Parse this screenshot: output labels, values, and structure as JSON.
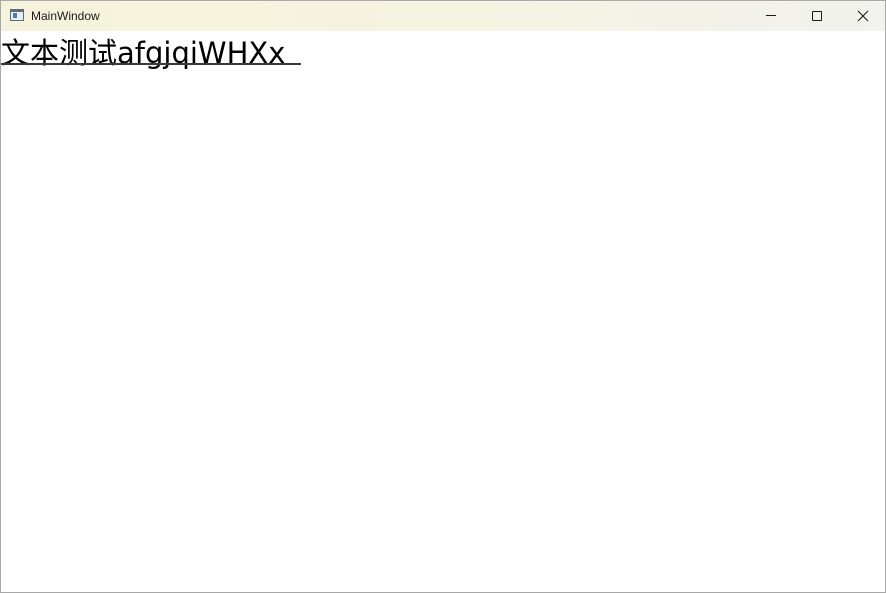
{
  "window": {
    "title": "MainWindow",
    "icon": "app-window-icon"
  },
  "caption_buttons": {
    "minimize": "minimize-icon",
    "maximize": "maximize-icon",
    "close": "close-icon"
  },
  "content": {
    "text": "文本测试afgjqiWHXx"
  }
}
